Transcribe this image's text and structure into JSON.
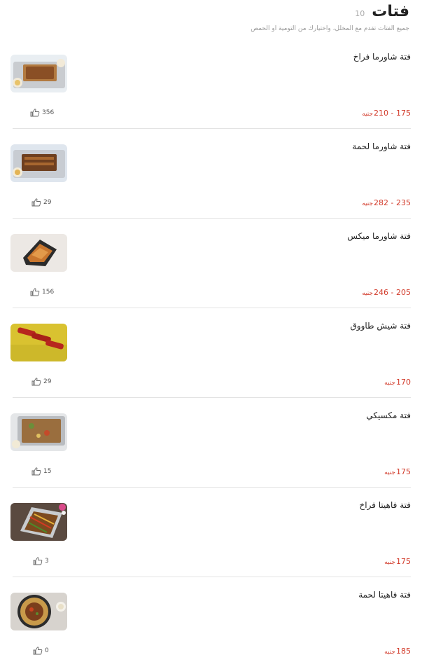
{
  "section": {
    "title": "فتات",
    "count": "10",
    "subtitle": "جميع الفتات تقدم مع المخلل، واختيارك من التومية او الحمص"
  },
  "currency": "جنيه",
  "colors": {
    "price": "#d23a2a",
    "divider": "#e3e3e3",
    "title": "#222222"
  },
  "items": [
    {
      "name": "فتة شاورما فراخ",
      "price": "175 - 210",
      "likes": "356",
      "image": "shawarma-chicken-fatteh"
    },
    {
      "name": "فتة شاورما لحمة",
      "price": "235 - 282",
      "likes": "29",
      "image": "shawarma-meat-fatteh"
    },
    {
      "name": "فتة شاورما ميكس",
      "price": "205 - 246",
      "likes": "156",
      "image": "shawarma-mix-fatteh"
    },
    {
      "name": "فتة شيش طاووق",
      "price": "170",
      "likes": "29",
      "image": "shish-tawook-fatteh"
    },
    {
      "name": "فتة مكسيكي",
      "price": "175",
      "likes": "15",
      "image": "mexican-fatteh"
    },
    {
      "name": "فتة فاهيتا فراخ",
      "price": "175",
      "likes": "3",
      "image": "fajita-chicken-fatteh"
    },
    {
      "name": "فتة فاهيتا لحمة",
      "price": "185",
      "likes": "0",
      "image": "fajita-meat-fatteh"
    }
  ]
}
